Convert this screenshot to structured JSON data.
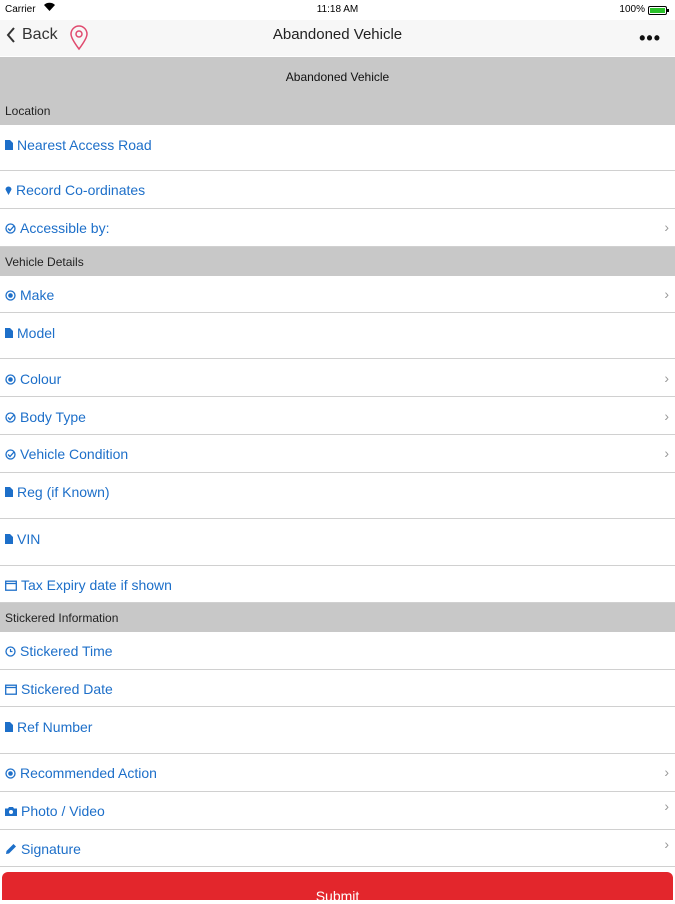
{
  "status": {
    "carrier": "Carrier",
    "time": "11:18 AM",
    "battery": "100%"
  },
  "nav": {
    "back": "Back",
    "title": "Abandoned Vehicle",
    "more": "•••"
  },
  "banner": {
    "title": "Abandoned Vehicle",
    "section": "Location"
  },
  "rows": {
    "nearest_access_road": "Nearest Access Road",
    "record_coordinates": "Record Co-ordinates",
    "accessible_by": "Accessible by:",
    "make": "Make",
    "model": "Model",
    "colour": "Colour",
    "body_type": "Body Type",
    "vehicle_condition": "Vehicle Condition",
    "reg": "Reg (if Known)",
    "vin": "VIN",
    "tax_expiry": "Tax Expiry date if shown",
    "stickered_time": "Stickered Time",
    "stickered_date": "Stickered Date",
    "ref_number": "Ref Number",
    "recommended_action": "Recommended Action",
    "photo_video": "Photo / Video",
    "signature": "Signature"
  },
  "headers": {
    "vehicle_details": "Vehicle Details",
    "stickered_information": "Stickered Information"
  },
  "chevron": "›",
  "submit": "Submit",
  "colors": {
    "accent": "#1d6fc9",
    "header_bg": "#c8c8c8",
    "submit": "#e3262c",
    "pin": "#e04a6e"
  }
}
